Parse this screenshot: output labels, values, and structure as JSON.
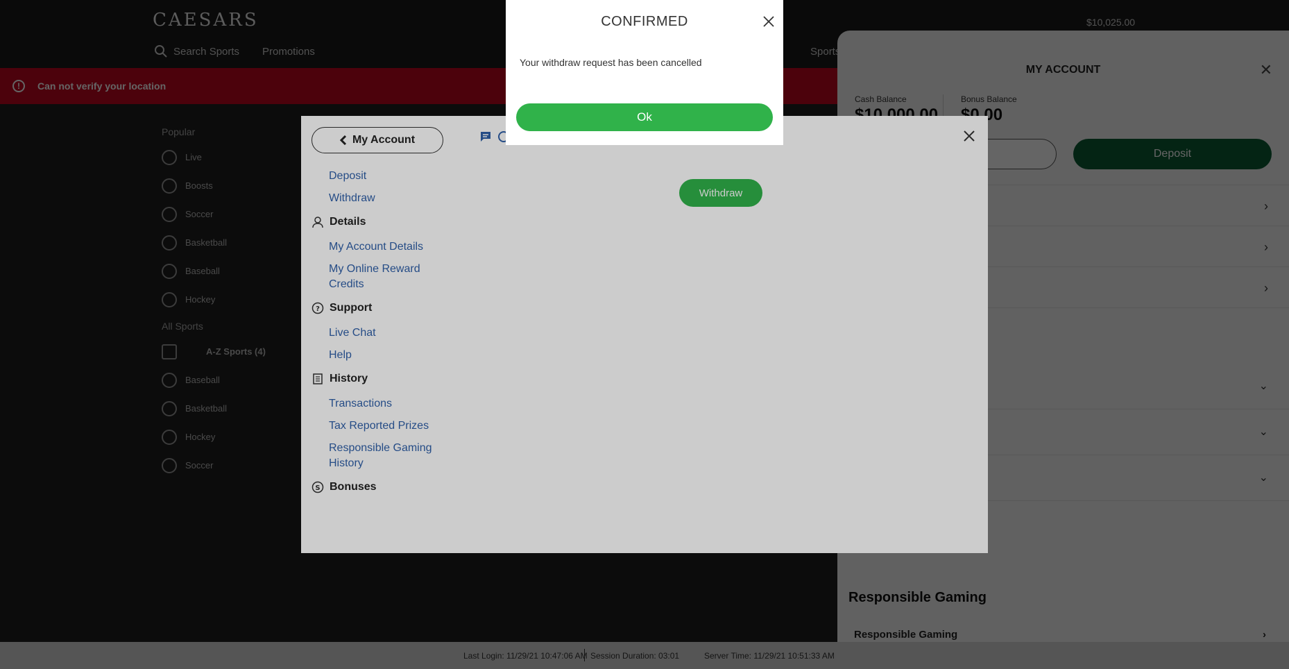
{
  "site": {
    "logo": "CAESARS",
    "search_label": "Search Sports",
    "promotions_label": "Promotions",
    "sports_label": "Sports",
    "header_balance": "$10,025.00",
    "alert": "Can not verify your location"
  },
  "left_nav": {
    "popular_heading": "Popular",
    "popular": [
      "Live",
      "Boosts",
      "Soccer",
      "Basketball",
      "Baseball",
      "Hockey"
    ],
    "all_sports_heading": "All Sports",
    "az_label": "A-Z Sports (4)",
    "all_sports": [
      "Baseball",
      "Basketball",
      "Hockey",
      "Soccer"
    ]
  },
  "account_panel": {
    "title": "MY ACCOUNT",
    "cash_label": "Cash Balance",
    "cash_value": "$10,000.00",
    "bonus_label": "Bonus Balance",
    "bonus_value": "$0.00",
    "deposit_label": "Deposit",
    "fragment_text": "e",
    "responsible_heading": "Responsible Gaming",
    "responsible_row": "Responsible Gaming"
  },
  "modal": {
    "back_label": "My Account",
    "withdraw_button": "Withdraw",
    "menu": {
      "deposit": "Deposit",
      "withdraw": "Withdraw",
      "details_heading": "Details",
      "account_details": "My Account Details",
      "reward_credits": "My Online Reward Credits",
      "support_heading": "Support",
      "live_chat": "Live Chat",
      "help": "Help",
      "history_heading": "History",
      "transactions": "Transactions",
      "tax_prizes": "Tax Reported Prizes",
      "rg_history": "Responsible Gaming History",
      "bonuses_heading": "Bonuses"
    }
  },
  "confirm_dialog": {
    "title": "CONFIRMED",
    "message": "Your withdraw request has been cancelled",
    "ok_label": "Ok"
  },
  "footer": {
    "last_login": "Last Login: 11/29/21 10:47:06 AM",
    "session": "Session Duration: 03:01",
    "server_time": "Server Time: 11/29/21 10:51:33 AM"
  },
  "colors": {
    "primary_green": "#30b24a",
    "dark_green": "#0c5a33",
    "alert_red": "#c0061e",
    "link_blue": "#2f5fa8"
  }
}
